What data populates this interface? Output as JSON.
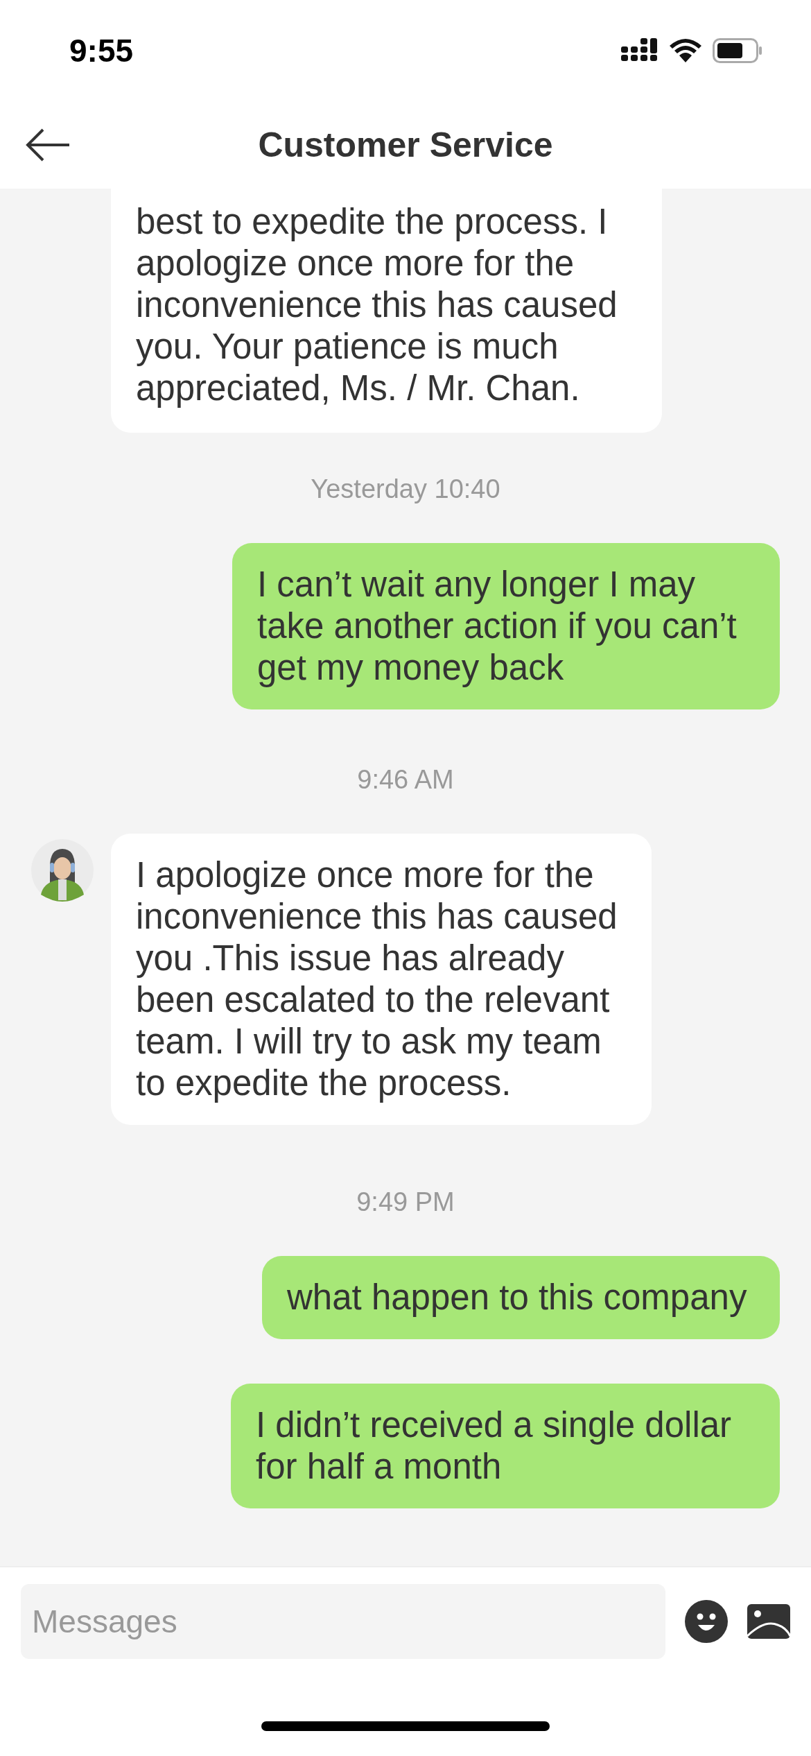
{
  "status_bar": {
    "time": "9:55"
  },
  "header": {
    "title": "Customer Service"
  },
  "messages": [
    {
      "kind": "incoming",
      "text": "best to expedite the process. I apologize once more for the inconvenience this has caused you. Your patience is much appreciated, Ms. / Mr. Chan.",
      "cut_top": true,
      "avatar": false
    },
    {
      "kind": "time",
      "text": "Yesterday 10:40"
    },
    {
      "kind": "outgoing",
      "text": "I can’t wait any longer I may take another action if you can’t get my money back"
    },
    {
      "kind": "time",
      "text": "9:46 AM"
    },
    {
      "kind": "incoming",
      "text": "I apologize once more for the inconvenience this has caused you .This issue has already been escalated to the relevant team. I will try to ask my team to expedite the process.",
      "cut_top": false,
      "avatar": true
    },
    {
      "kind": "time",
      "text": "9:49 PM"
    },
    {
      "kind": "outgoing",
      "text": "what happen to this company"
    },
    {
      "kind": "outgoing",
      "text": " I didn’t received a single dollar for half a month"
    }
  ],
  "composer": {
    "placeholder": "Messages"
  }
}
